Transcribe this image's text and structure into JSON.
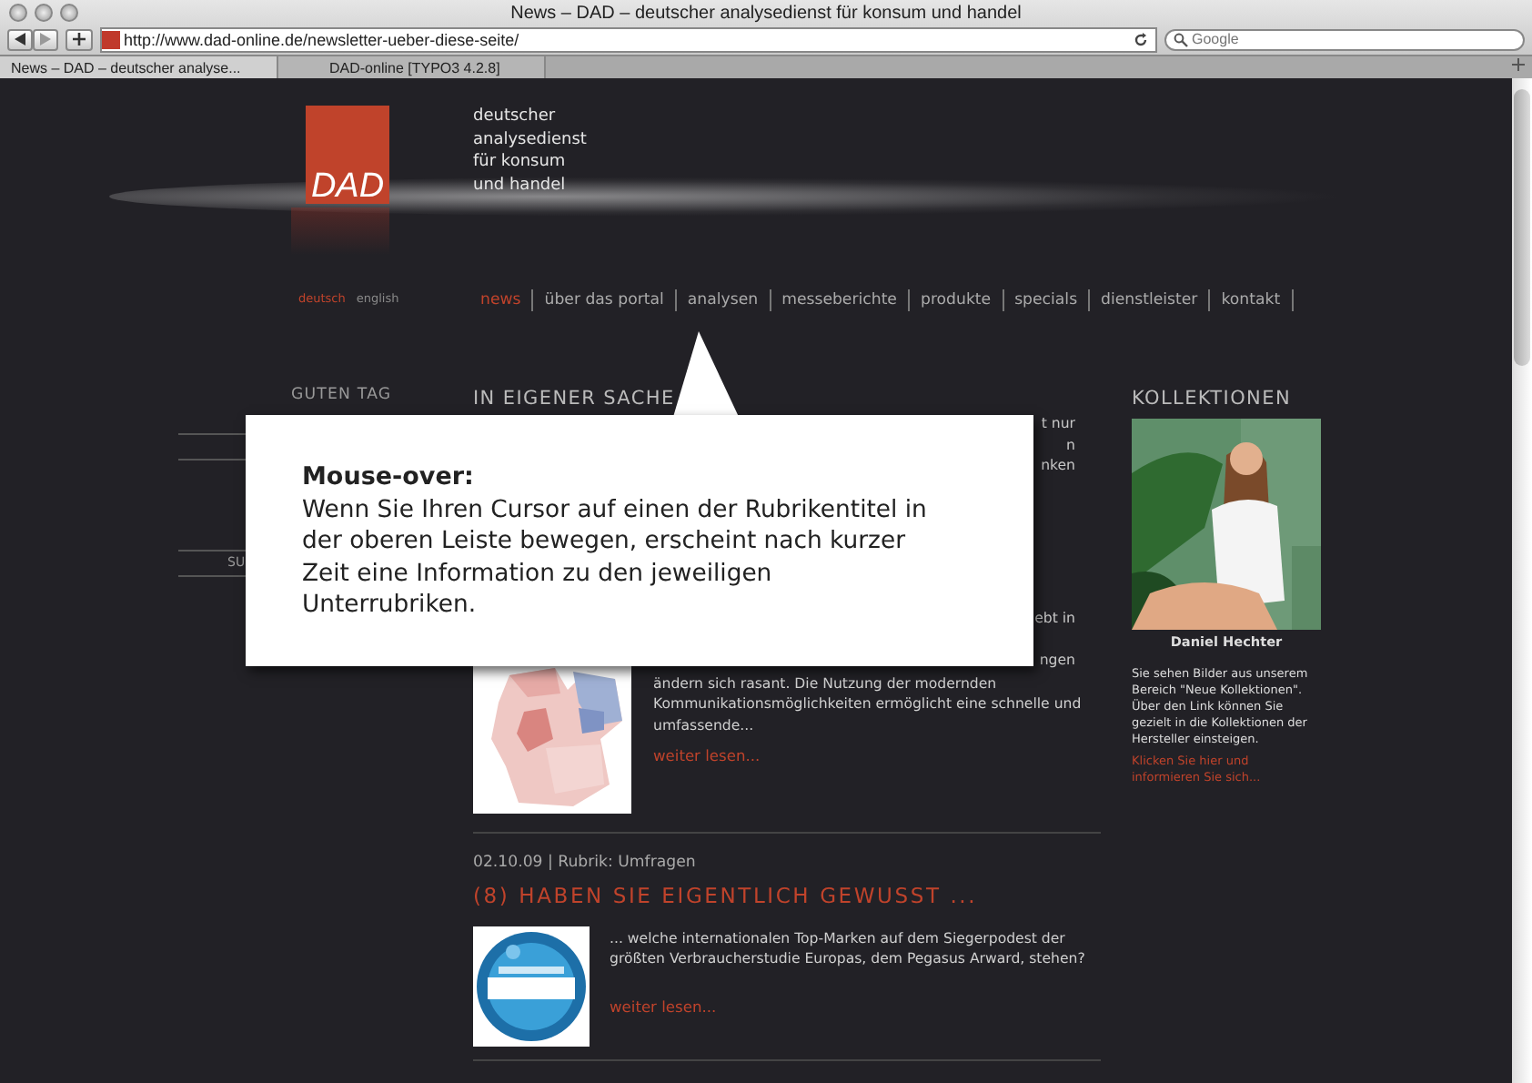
{
  "window": {
    "title": "News – DAD – deutscher analysedienst für konsum und handel"
  },
  "toolbar": {
    "url": "http://www.dad-online.de/newsletter-ueber-diese-seite/",
    "search": {
      "placeholder": "Google"
    }
  },
  "tabs": [
    {
      "label": "News – DAD – deutscher analyse...",
      "selected": true
    },
    {
      "label": "DAD-online [TYPO3 4.2.8]",
      "selected": false
    }
  ],
  "logo": {
    "text": "DAD",
    "tagline": [
      "deutscher",
      "analysedienst",
      "für konsum",
      "und handel"
    ]
  },
  "languages": [
    {
      "label": "deutsch",
      "selected": true
    },
    {
      "label": "english",
      "selected": false
    }
  ],
  "nav": [
    {
      "label": "news",
      "selected": true
    },
    {
      "label": "über das portal",
      "selected": false
    },
    {
      "label": "analysen",
      "selected": false
    },
    {
      "label": "messeberichte",
      "selected": false
    },
    {
      "label": "produkte",
      "selected": false
    },
    {
      "label": "specials",
      "selected": false
    },
    {
      "label": "dienstleister",
      "selected": false
    },
    {
      "label": "kontakt",
      "selected": false
    }
  ],
  "sidebar": {
    "heading": "GUTEN TAG",
    "items": [
      "SU"
    ]
  },
  "main": {
    "heading": "IN EIGENER SACHE",
    "hidden_fragments": [
      "t nur",
      "n",
      "nken"
    ],
    "articles": [
      {
        "fragments": [
          "ebt in",
          "ngen"
        ],
        "text": "ändern sich rasant. Die Nutzung der modernden Kommunikationsmöglichkeiten ermöglicht eine schnelle und umfassende...",
        "more": "weiter lesen..."
      },
      {
        "meta": "02.10.09 | Rubrik: Umfragen",
        "title": "(8) HABEN SIE EIGENTLICH GEWUSST ...",
        "text": "... welche internationalen Top-Marken auf dem Siegerpodest der größten Verbraucherstudie Europas, dem Pegasus Arward, stehen?",
        "more": "weiter lesen..."
      }
    ]
  },
  "collections": {
    "heading": "KOLLEKTIONEN",
    "caption": "Daniel Hechter",
    "text": "Sie sehen Bilder aus unserem Bereich \"Neue Kollektionen\". Über den Link können Sie gezielt in die Kollektionen der Hersteller einsteigen.",
    "link": "Klicken Sie hier und informieren Sie sich..."
  },
  "tooltip": {
    "title": "Mouse-over:",
    "text": "Wenn Sie Ihren Cursor auf einen der Rubrikentitel in der oberen Leiste bewegen, erscheint nach kurzer Zeit eine Information zu den jeweiligen Unterrubriken."
  }
}
